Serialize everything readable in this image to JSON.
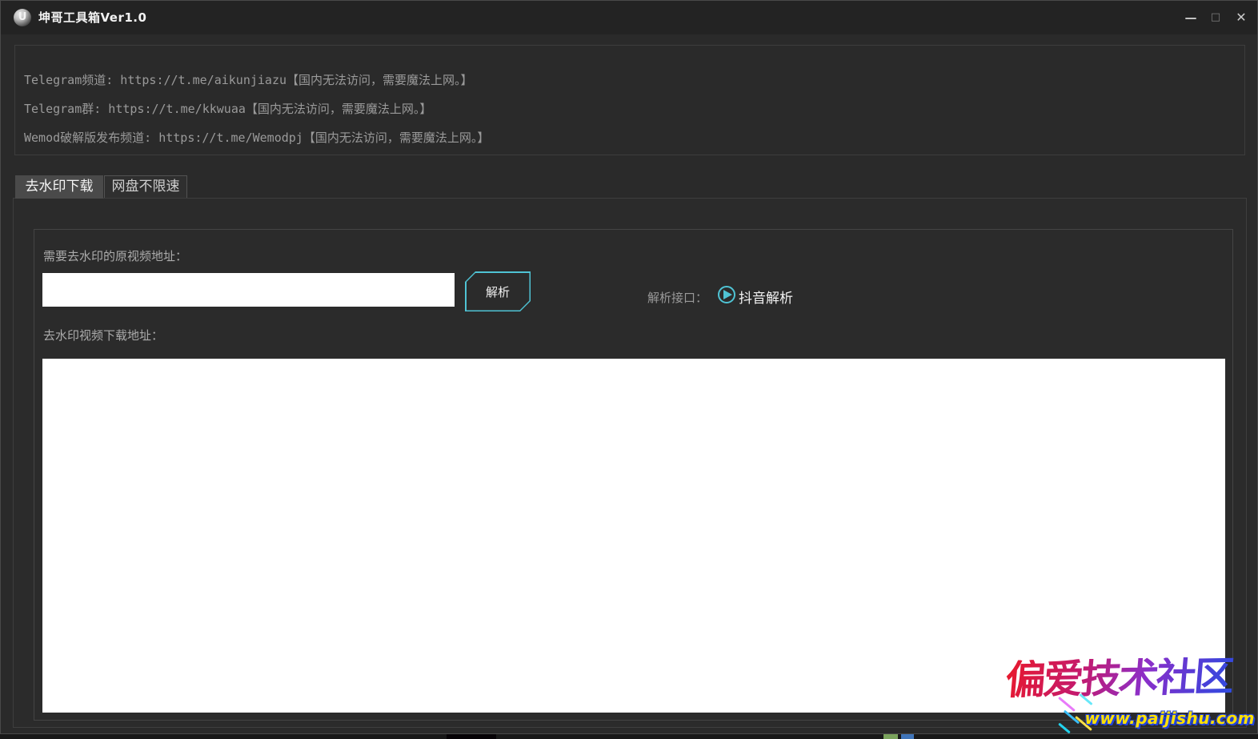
{
  "window": {
    "title": "坤哥工具箱Ver1.0",
    "icon_glyph": "U",
    "controls": {
      "minimize": "—",
      "maximize": "□",
      "close": "✕"
    }
  },
  "info_panel": {
    "lines": [
      "Telegram频道: https://t.me/aikunjiazu【国内无法访问，需要魔法上网。】",
      "Telegram群: https://t.me/kkwuaa【国内无法访问，需要魔法上网。】",
      "Wemod破解版发布频道: https://t.me/Wemodpj【国内无法访问，需要魔法上网。】"
    ]
  },
  "tabs": [
    {
      "label": "去水印下载",
      "active": true
    },
    {
      "label": "网盘不限速",
      "active": false
    }
  ],
  "form": {
    "source_label": "需要去水印的原视频地址：",
    "source_value": "",
    "parse_button": "解析",
    "interface_label": "解析接口：",
    "interface_option": "抖音解析",
    "interface_selected": true,
    "result_label": "去水印视频下载地址：",
    "result_value": ""
  },
  "colors": {
    "accent_cyan": "#4fc3d4",
    "window_bg": "#2b2b2b",
    "titlebar_bg": "#232323",
    "text_gray": "#9a9a9a"
  },
  "watermark": {
    "title": "偏爱技术社区",
    "url": "www.paijishu.com"
  }
}
